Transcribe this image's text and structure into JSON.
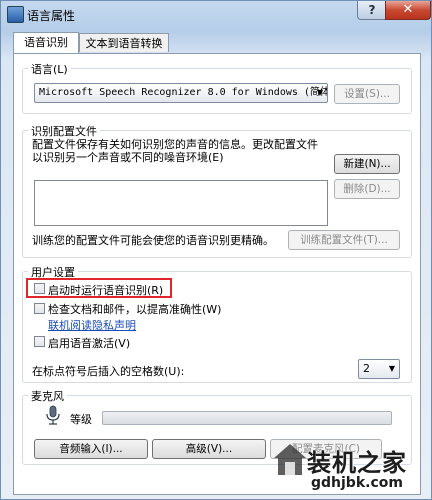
{
  "window": {
    "title": "语言属性",
    "help_label": "?",
    "close_label": "✕"
  },
  "tabs": [
    {
      "label": "语音识别",
      "active": true
    },
    {
      "label": "文本到语音转换",
      "active": false
    }
  ],
  "language": {
    "group_label": "语言(L)",
    "selected": "Microsoft Speech Recognizer 8.0 for Windows (简体中",
    "settings_button": "设置(S)..."
  },
  "profiles": {
    "group_label": "识别配置文件",
    "description_line1": "配置文件保存有关如何识别您的声音的信息。更改配置文件",
    "description_line2": "以识别另一个声音或不同的噪音环境(E)",
    "new_button": "新建(N)...",
    "delete_button": "删除(D)...",
    "train_hint": "训练您的配置文件可能会使您的语音识别更精确。",
    "train_button": "训练配置文件(T)..."
  },
  "user_settings": {
    "group_label": "用户设置",
    "run_at_startup": "启动时运行语音识别(R)",
    "review_docs": "检查文档和邮件，以提高准确性(W)",
    "privacy_link": "联机阅读隐私声明",
    "voice_activation": "启用语音激活(V)",
    "spaces_label": "在标点符号后插入的空格数(U):",
    "spaces_value": "2"
  },
  "microphone": {
    "group_label": "麦克风",
    "level_label": "等级",
    "audio_input_button": "音频输入(I)...",
    "advanced_button": "高级(V)...",
    "configure_button": "配置麦克风(C)"
  },
  "watermark": {
    "brand": "装机之家",
    "url": "gdhjbk.com"
  },
  "colors": {
    "highlight": "#e0262b",
    "link": "#1a4db8",
    "close_button": "#c84a33"
  }
}
